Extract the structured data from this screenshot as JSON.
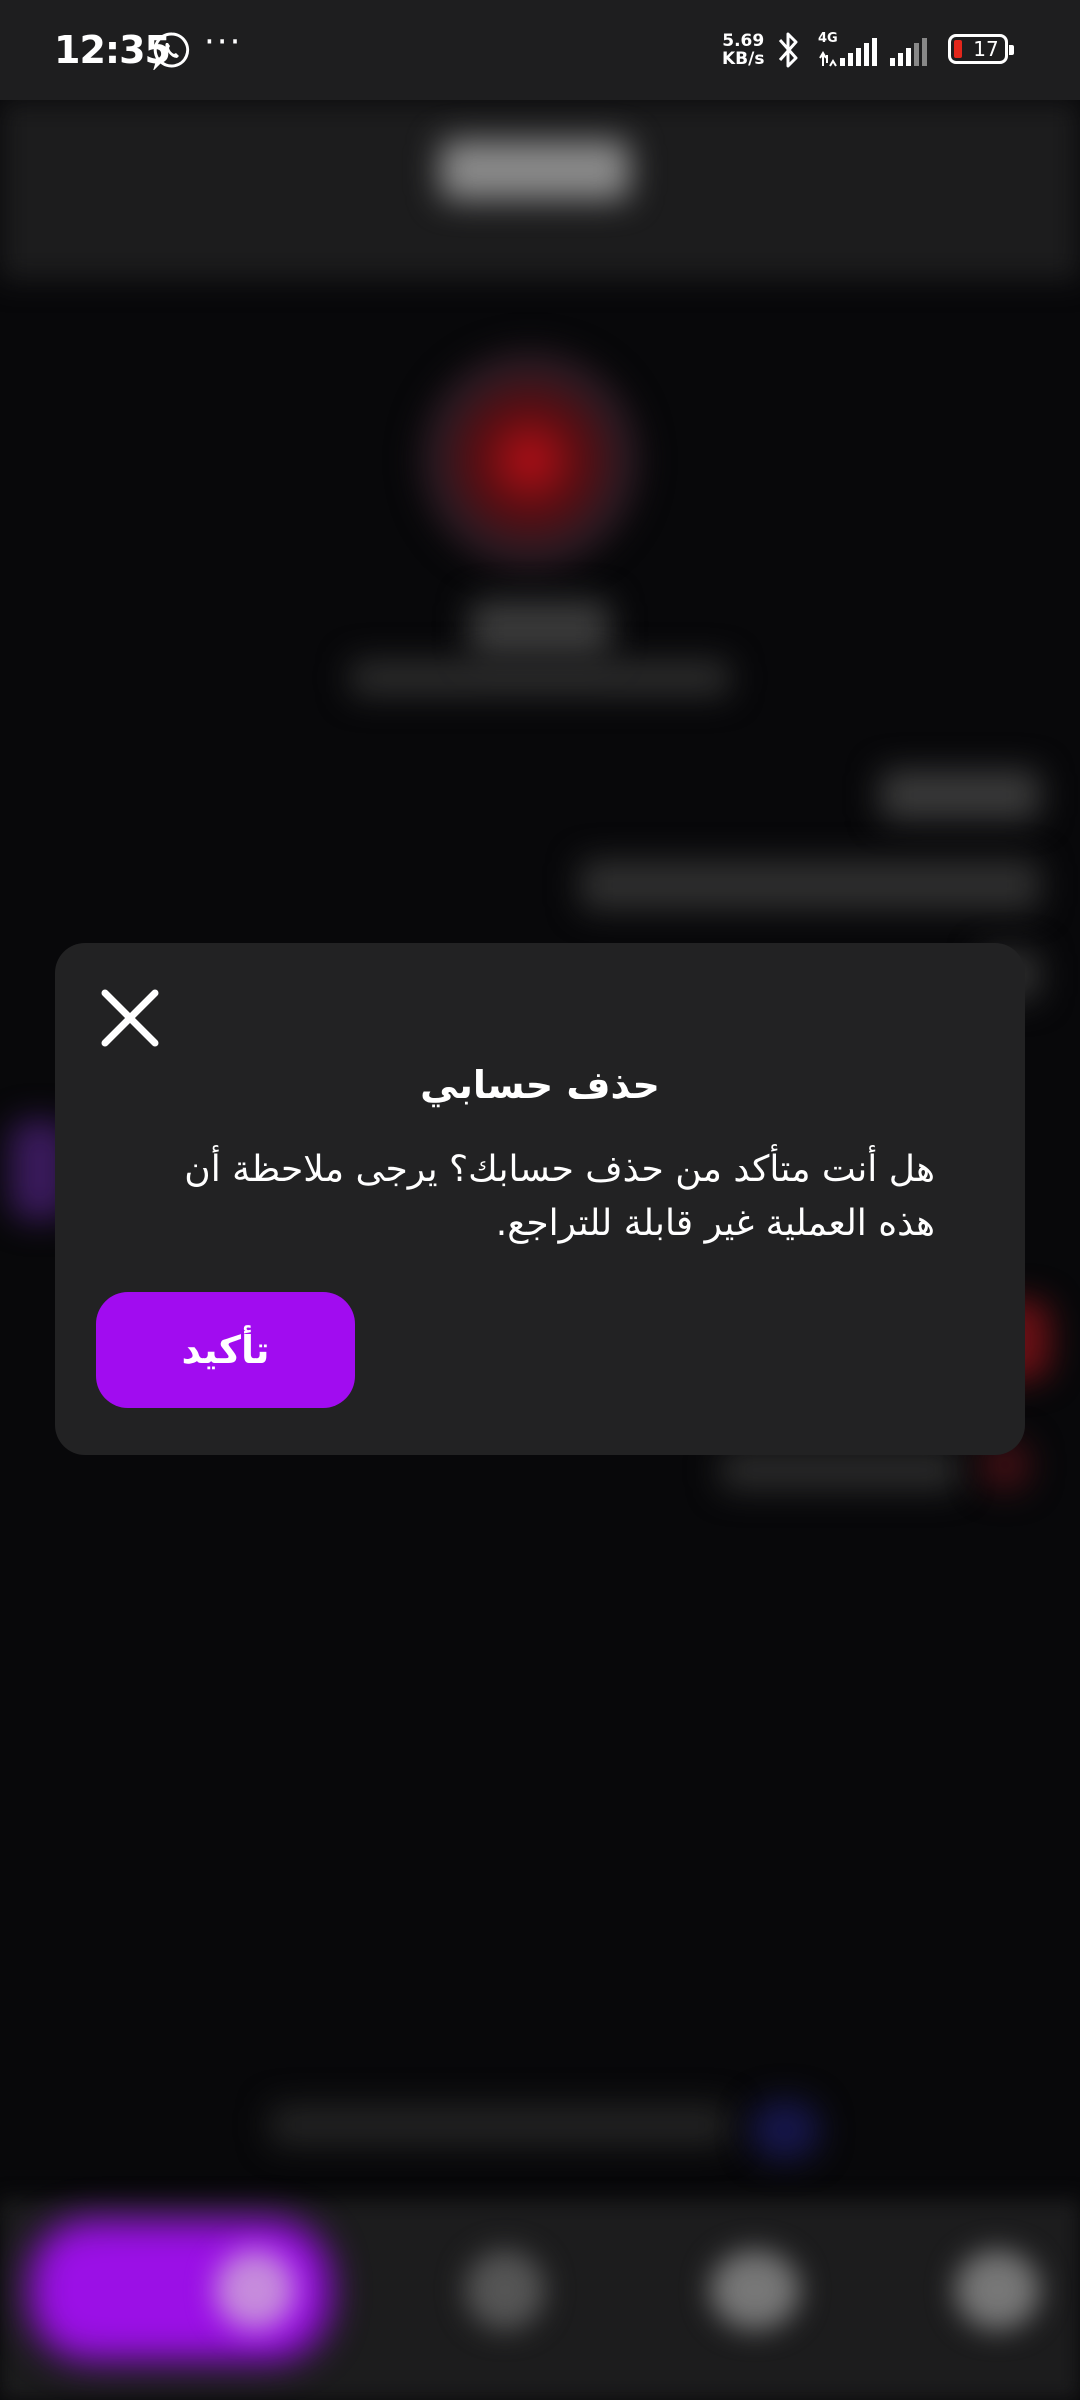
{
  "status_bar": {
    "time": "12:35",
    "network_speed_value": "5.69",
    "network_speed_unit": "KB/s",
    "battery_level": "17",
    "icons": [
      "whatsapp-icon",
      "more-dots-icon",
      "bluetooth-icon",
      "signal-4g-icon",
      "signal-icon",
      "battery-icon"
    ],
    "more_dots": "···"
  },
  "dialog": {
    "title": "حذف حسابي",
    "message": "هل أنت متأكد من حذف حسابك؟ يرجى ملاحظة أن هذه العملية غير قابلة للتراجع.",
    "confirm_label": "تأكيد",
    "close_icon": "close-icon"
  },
  "colors": {
    "accent": "#a10cf0",
    "dialog_background": "#222223",
    "screen_background": "#08080a",
    "battery_low": "#e2261b"
  }
}
